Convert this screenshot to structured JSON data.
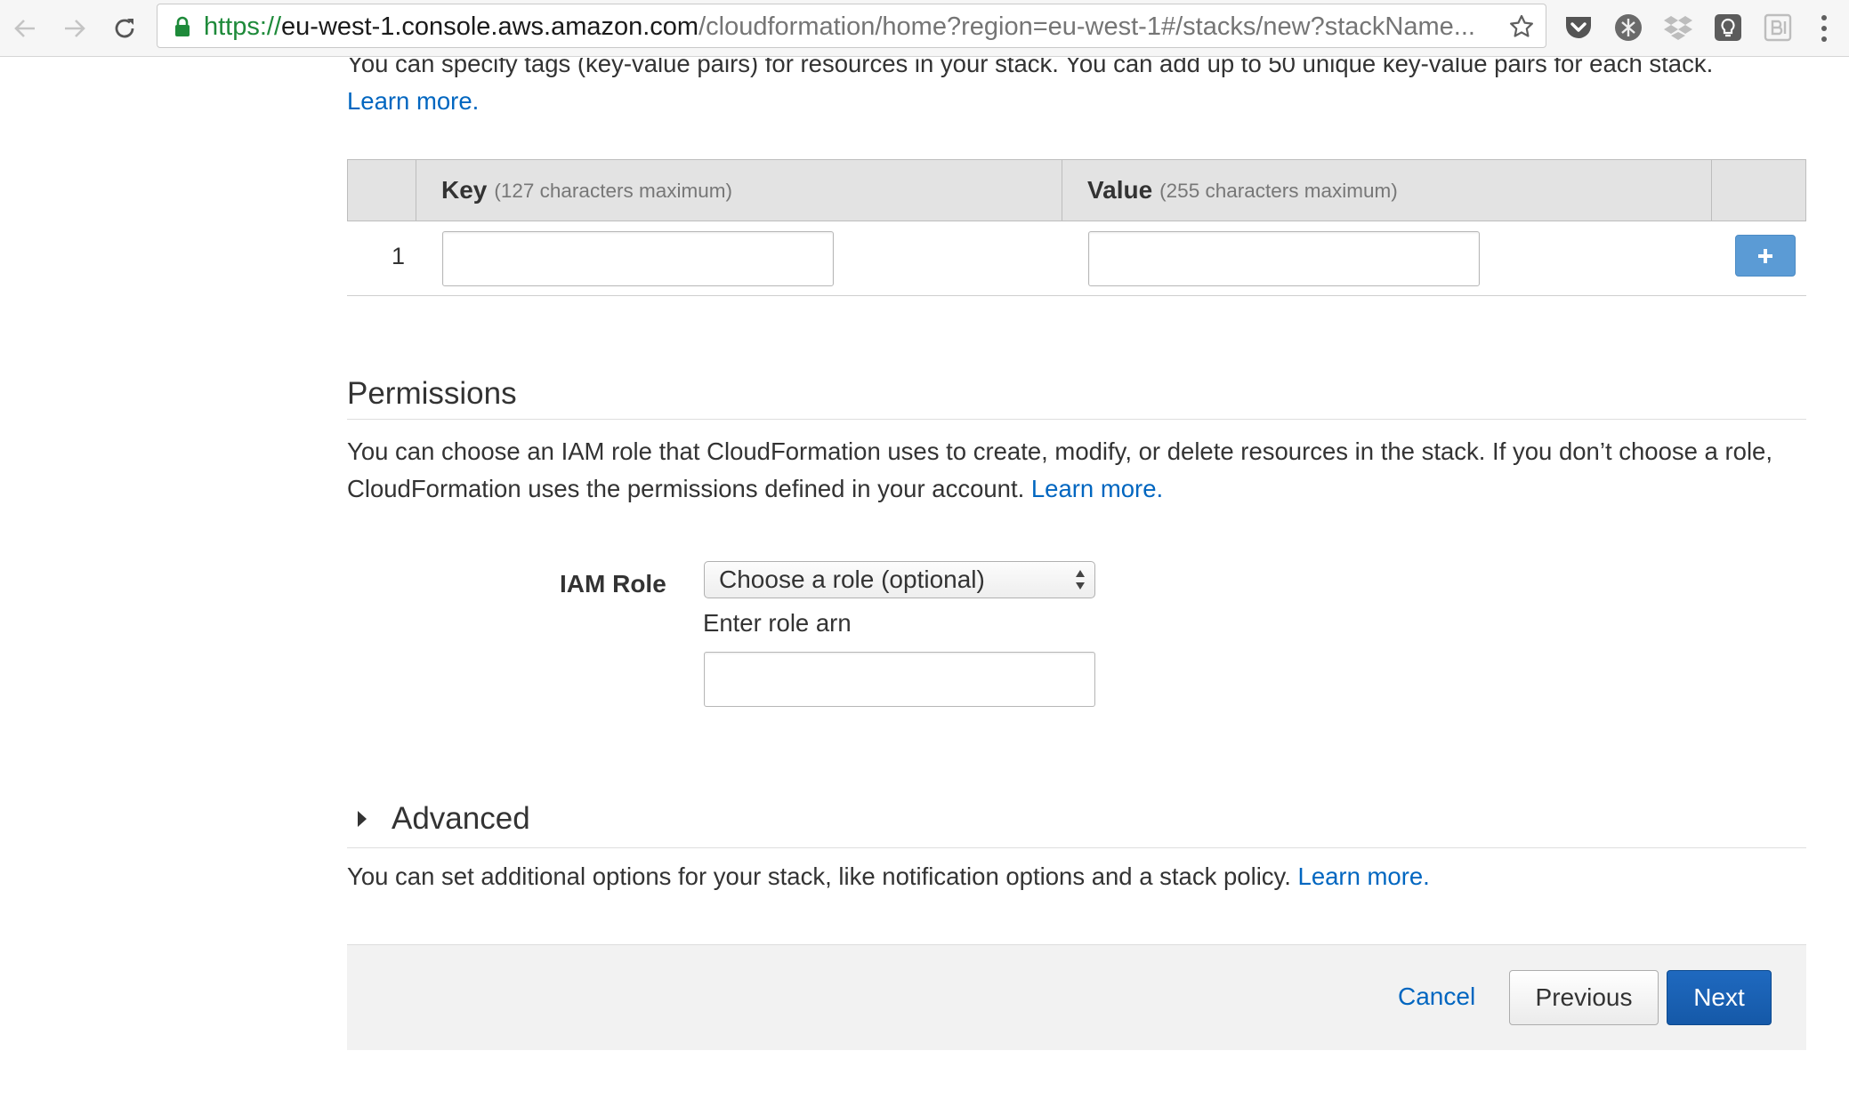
{
  "browser": {
    "url_scheme": "https://",
    "url_host": "eu-west-1.console.aws.amazon.com",
    "url_path": "/cloudformation/home?region=eu-west-1#/stacks/new?stackName...",
    "extensions": [
      "pocket-icon",
      "bug-extension-icon",
      "dropbox-icon",
      "lightbulb-extension-icon",
      "bitly-extension-icon"
    ]
  },
  "tags": {
    "intro": "You can specify tags (key-value pairs) for resources in your stack. You can add up to 50 unique key-value pairs for each stack.",
    "learn_more": "Learn more.",
    "table": {
      "key_header": "Key",
      "key_hint": "(127 characters maximum)",
      "value_header": "Value",
      "value_hint": "(255 characters maximum)",
      "rows": [
        {
          "number": "1",
          "key": "",
          "value": ""
        }
      ],
      "add_label": "+"
    }
  },
  "permissions": {
    "title": "Permissions",
    "description": "You can choose an IAM role that CloudFormation uses to create, modify, or delete resources in the stack. If you don’t choose a role, CloudFormation uses the permissions defined in your account.",
    "learn_more": "Learn more.",
    "iam_role_label": "IAM Role",
    "role_select_value": "Choose a role (optional)",
    "arn_label": "Enter role arn",
    "arn_value": ""
  },
  "advanced": {
    "title": "Advanced",
    "description": "You can set additional options for your stack, like notification options and a stack policy.",
    "learn_more": "Learn more."
  },
  "footer": {
    "cancel": "Cancel",
    "previous": "Previous",
    "next": "Next"
  },
  "colors": {
    "link": "#0066c0",
    "primary_button": "#1559a8",
    "add_button": "#5b9bd5",
    "secure_green": "#1e8a3a"
  }
}
